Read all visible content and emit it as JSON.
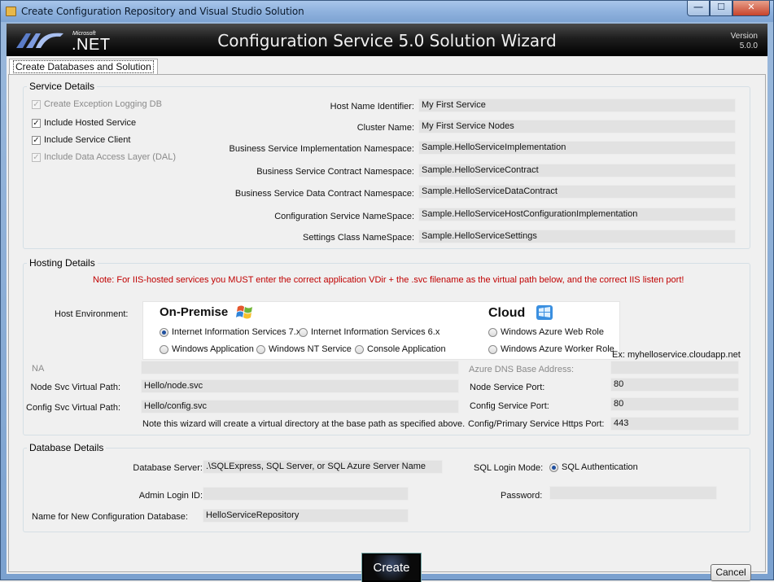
{
  "window": {
    "title": "Create Configuration Repository and Visual Studio Solution",
    "minimize": "—",
    "maximize": "☐",
    "close": "✕"
  },
  "banner": {
    "logo_microsoft": "Microsoft",
    "logo_net": ".NET",
    "title": "Configuration Service 5.0 Solution Wizard",
    "version_label": "Version",
    "version_value": "5.0.0"
  },
  "tab": {
    "label": "Create Databases and Solution"
  },
  "service_details": {
    "title": "Service Details",
    "checkboxes": [
      {
        "label": "Create Exception Logging DB",
        "checked": true,
        "enabled": false
      },
      {
        "label": "Include Hosted Service",
        "checked": true,
        "enabled": true
      },
      {
        "label": "Include Service Client",
        "checked": true,
        "enabled": true
      },
      {
        "label": "Include Data Access Layer (DAL)",
        "checked": true,
        "enabled": false
      }
    ],
    "fields": [
      {
        "label": "Host Name Identifier:",
        "value": "My First Service"
      },
      {
        "label": "Cluster Name:",
        "value": "My First Service Nodes"
      },
      {
        "label": "Business Service Implementation Namespace:",
        "value": "Sample.HelloServiceImplementation"
      },
      {
        "label": "Business Service Contract Namespace:",
        "value": "Sample.HelloServiceContract"
      },
      {
        "label": "Business Service Data Contract Namespace:",
        "value": "Sample.HelloServiceDataContract"
      },
      {
        "label": "Configuration Service NameSpace:",
        "value": "Sample.HelloServiceHostConfigurationImplementation"
      },
      {
        "label": "Settings Class NameSpace:",
        "value": "Sample.HelloServiceSettings"
      }
    ]
  },
  "hosting_details": {
    "title": "Hosting Details",
    "note": "Note:  For IIS-hosted services you MUST enter the correct application VDir + the .svc filename as the virtual path below, and the correct IIS listen port!",
    "host_env_label": "Host Environment:",
    "on_premise": "On-Premise",
    "cloud": "Cloud",
    "options": {
      "iis7": "Internet Information Services 7.x",
      "iis6": "Internet Information Services 6.x",
      "win_app": "Windows Application",
      "nt_service": "Windows NT Service",
      "console": "Console Application",
      "azure_web": "Windows Azure Web Role",
      "azure_worker": "Windows Azure Worker Role"
    },
    "selected": "iis7",
    "na_label": "NA",
    "na_value": "",
    "node_vpath_label": "Node Svc Virtual Path:",
    "node_vpath_value": "Hello/node.svc",
    "config_vpath_label": "Config Svc Virtual Path:",
    "config_vpath_value": "Hello/config.svc",
    "vdir_note": "Note this wizard will create a virtual directory at the base path as specified above.",
    "dns_example": "Ex: myhelloservice.cloudapp.net",
    "dns_label": "Azure DNS Base Address:",
    "dns_value": "",
    "node_port_label": "Node Service Port:",
    "node_port_value": "80",
    "config_port_label": "Config Service Port:",
    "config_port_value": "80",
    "https_port_label": "Config/Primary Service Https Port:",
    "https_port_value": "443"
  },
  "database_details": {
    "title": "Database Details",
    "server_label": "Database Server:",
    "server_value": ".\\SQLExpress, SQL Server, or SQL Azure Server Name",
    "login_mode_label": "SQL Login Mode:",
    "login_mode_value": "SQL Authentication",
    "admin_label": "Admin Login ID:",
    "admin_value": "",
    "password_label": "Password:",
    "password_value": "",
    "dbname_label": "Name for New Configuration Database:",
    "dbname_value": "HelloServiceRepository"
  },
  "buttons": {
    "create": "Create",
    "cancel": "Cancel"
  },
  "colors": {
    "note_red": "#c00000",
    "banner_bg": "#000000",
    "textbox_bg": "#e2e2e2"
  }
}
